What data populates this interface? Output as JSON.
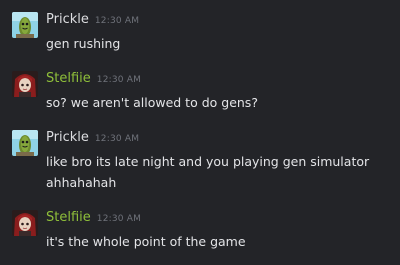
{
  "messages": [
    {
      "author": "Prickle",
      "time": "12:30 AM",
      "avatar_icon": "pickle-avatar-icon",
      "name_color": "#dcdde0",
      "lines": [
        "gen rushing"
      ]
    },
    {
      "author": "Stelfiie",
      "time": "12:30 AM",
      "avatar_icon": "red-hair-character-avatar-icon",
      "name_color": "#8fbf3a",
      "lines": [
        "so? we aren't allowed to do gens?"
      ]
    },
    {
      "author": "Prickle",
      "time": "12:30 AM",
      "avatar_icon": "pickle-avatar-icon",
      "name_color": "#dcdde0",
      "lines": [
        "like bro its late night and you playing gen simulator",
        "ahhahahah"
      ]
    },
    {
      "author": "Stelfiie",
      "time": "12:30 AM",
      "avatar_icon": "red-hair-character-avatar-icon",
      "name_color": "#8fbf3a",
      "lines": [
        "it's the whole point of the game"
      ]
    }
  ]
}
